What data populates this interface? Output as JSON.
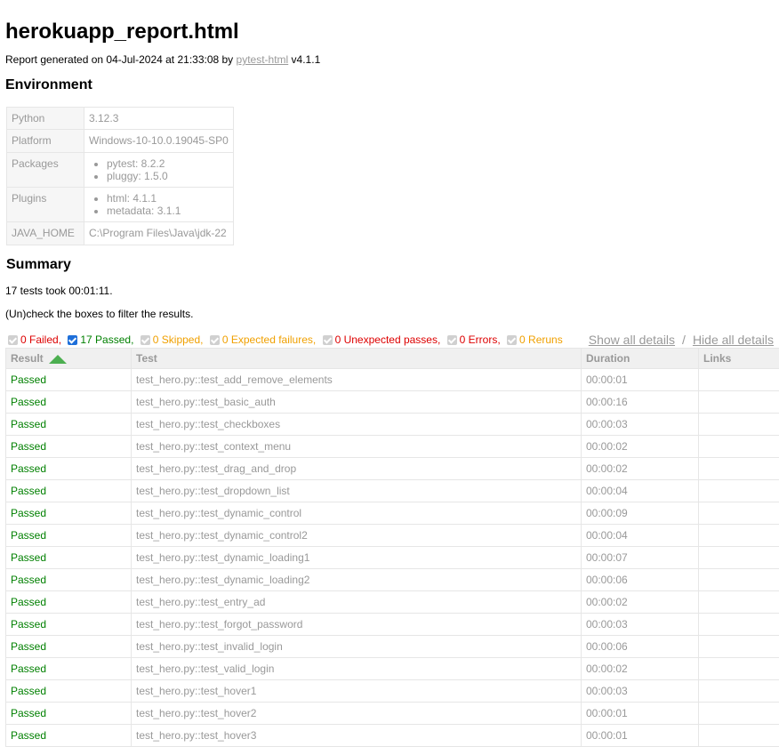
{
  "report": {
    "title": "herokuapp_report.html",
    "generated_prefix": "Report generated on 04-Jul-2024 at 21:33:08 by ",
    "generator_link": "pytest-html",
    "generator_version": " v4.1.1"
  },
  "environment": {
    "heading": "Environment",
    "python_key": "Python",
    "python_val": "3.12.3",
    "platform_key": "Platform",
    "platform_val": "Windows-10-10.0.19045-SP0",
    "packages_key": "Packages",
    "packages": [
      "pytest: 8.2.2",
      "pluggy: 1.5.0"
    ],
    "plugins_key": "Plugins",
    "plugins": [
      "html: 4.1.1",
      "metadata: 3.1.1"
    ],
    "java_key": "JAVA_HOME",
    "java_val": "C:\\Program Files\\Java\\jdk-22"
  },
  "summary": {
    "heading": "Summary",
    "duration_text": "17 tests took 00:01:11.",
    "filter_hint": "(Un)check the boxes to filter the results."
  },
  "filters": {
    "failed": "0 Failed,",
    "passed": "17 Passed,",
    "skipped": "0 Skipped,",
    "xfailed": "0 Expected failures,",
    "xpassed": "0 Unexpected passes,",
    "errors": "0 Errors,",
    "reruns": "0 Reruns",
    "show_details": "Show all details",
    "hide_details": "Hide all details",
    "separator": "/"
  },
  "results": {
    "columns": {
      "result": "Result",
      "test": "Test",
      "duration": "Duration",
      "links": "Links"
    },
    "rows": [
      {
        "result": "Passed",
        "test": "test_hero.py::test_add_remove_elements",
        "duration": "00:00:01"
      },
      {
        "result": "Passed",
        "test": "test_hero.py::test_basic_auth",
        "duration": "00:00:16"
      },
      {
        "result": "Passed",
        "test": "test_hero.py::test_checkboxes",
        "duration": "00:00:03"
      },
      {
        "result": "Passed",
        "test": "test_hero.py::test_context_menu",
        "duration": "00:00:02"
      },
      {
        "result": "Passed",
        "test": "test_hero.py::test_drag_and_drop",
        "duration": "00:00:02"
      },
      {
        "result": "Passed",
        "test": "test_hero.py::test_dropdown_list",
        "duration": "00:00:04"
      },
      {
        "result": "Passed",
        "test": "test_hero.py::test_dynamic_control",
        "duration": "00:00:09"
      },
      {
        "result": "Passed",
        "test": "test_hero.py::test_dynamic_control2",
        "duration": "00:00:04"
      },
      {
        "result": "Passed",
        "test": "test_hero.py::test_dynamic_loading1",
        "duration": "00:00:07"
      },
      {
        "result": "Passed",
        "test": "test_hero.py::test_dynamic_loading2",
        "duration": "00:00:06"
      },
      {
        "result": "Passed",
        "test": "test_hero.py::test_entry_ad",
        "duration": "00:00:02"
      },
      {
        "result": "Passed",
        "test": "test_hero.py::test_forgot_password",
        "duration": "00:00:03"
      },
      {
        "result": "Passed",
        "test": "test_hero.py::test_invalid_login",
        "duration": "00:00:06"
      },
      {
        "result": "Passed",
        "test": "test_hero.py::test_valid_login",
        "duration": "00:00:02"
      },
      {
        "result": "Passed",
        "test": "test_hero.py::test_hover1",
        "duration": "00:00:03"
      },
      {
        "result": "Passed",
        "test": "test_hero.py::test_hover2",
        "duration": "00:00:01"
      },
      {
        "result": "Passed",
        "test": "test_hero.py::test_hover3",
        "duration": "00:00:01"
      }
    ]
  }
}
